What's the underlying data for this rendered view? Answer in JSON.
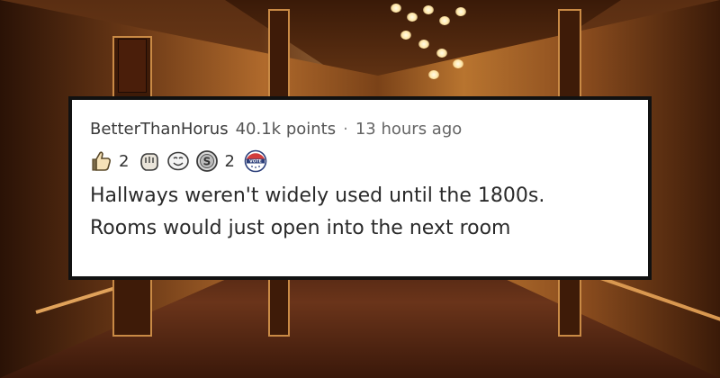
{
  "comment": {
    "username": "BetterThanHorus",
    "points": "40.1k points",
    "separator": "·",
    "time": "13 hours ago",
    "awards": [
      {
        "icon": "thumbs-up-award-icon",
        "count": "2"
      },
      {
        "icon": "helpful-hand-award-icon",
        "count": ""
      },
      {
        "icon": "laughing-face-award-icon",
        "count": ""
      },
      {
        "icon": "silver-coin-award-icon",
        "count": "2"
      },
      {
        "icon": "vote-badge-award-icon",
        "count": ""
      }
    ],
    "body_lines": [
      "Hallways weren't widely used until the 1800s.",
      "Rooms would just open into the next room"
    ]
  },
  "colors": {
    "card_background": "#ffffff",
    "card_border": "#111111",
    "text_primary": "#2a2a2a",
    "text_meta": "#4a4a4a"
  }
}
